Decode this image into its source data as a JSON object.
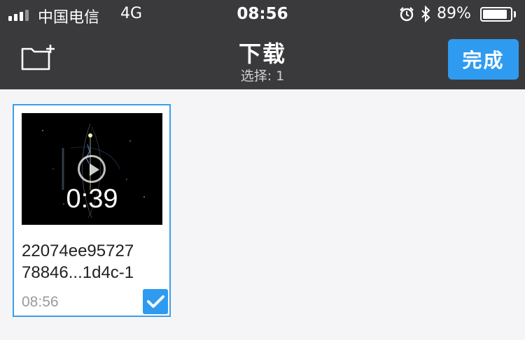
{
  "status_bar": {
    "carrier": "中国电信",
    "network": "4G",
    "time": "08:56",
    "battery_percent_text": "89%",
    "battery_level": 0.89,
    "signal_bars_filled": 4,
    "icons": [
      "signal-icon",
      "alarm-icon",
      "bluetooth-icon",
      "battery-icon"
    ]
  },
  "nav": {
    "title": "下载",
    "subtitle": "选择: 1",
    "done_label": "完成",
    "left_icon": "new-folder-icon"
  },
  "files": [
    {
      "name_line1": "22074ee95727",
      "name_line2": "78846...1d4c-1",
      "duration": "0:39",
      "time": "08:56",
      "selected": true
    }
  ],
  "colors": {
    "bar_bg": "#3a3a3c",
    "accent": "#2e9bf0",
    "content_bg": "#f5f5f7"
  }
}
